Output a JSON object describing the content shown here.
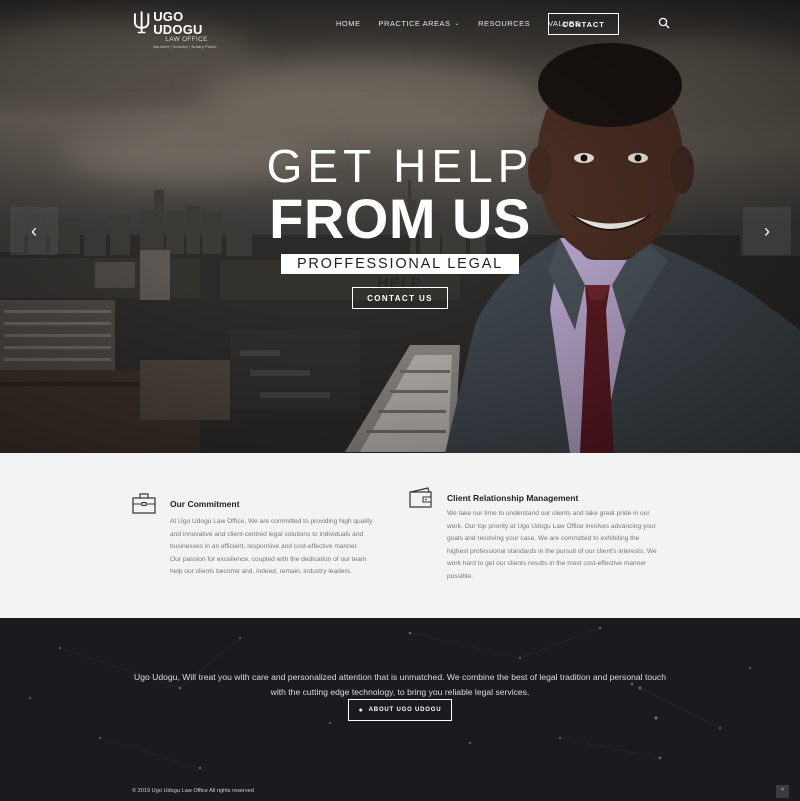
{
  "brand": {
    "name": "UGO UDOGU",
    "sub": "LAW OFFICE",
    "tagline": "Barrister | Solicitor | Notary Public"
  },
  "nav": {
    "items": [
      {
        "label": "HOME"
      },
      {
        "label": "PRACTICE AREAS",
        "has_dropdown": true
      },
      {
        "label": "RESOURCES"
      },
      {
        "label": "VALUES"
      }
    ],
    "contact_label": "CONTACT",
    "search_icon": "search-icon"
  },
  "hero": {
    "line1": "GET HELP",
    "line2": "FROM US",
    "line3": "PROFFESSIONAL LEGAL HELP",
    "cta_label": "CONTACT US",
    "arrow_left": "‹",
    "arrow_right": "›"
  },
  "features": [
    {
      "icon": "briefcase-icon",
      "title": "Our Commitment",
      "lines": [
        "At Ugo Udogu Law Office, We are committed to providing high quality",
        "and innovative and client-centred legal solutions to individuals and",
        "businesses in an efficient, responsive and cost-effective manner.",
        "Our passion for excellence, coupled with the dedication of our team",
        "help our clients become and, indeed, remain, industry leaders."
      ]
    },
    {
      "icon": "wallet-icon",
      "title": "Client Relationship Management",
      "lines": [
        "We take our time to understand our clients and take great pride in our",
        "work. Our top priority at Ugo Udogu Law Office involves advancing your",
        "goals and resolving your case. We are committed to exhibiting the",
        "highest professional standards in the pursuit of our client's interests. We",
        "work hard to get our clients results in the most cost-effective manner",
        "possible."
      ]
    }
  ],
  "footer": {
    "line1": "Ugo Udogu, Will treat you with care and personalized attention that is unmatched. We combine the best of legal tradition and personal touch",
    "line2": "with the cutting edge technology, to bring you reliable legal services.",
    "about_label": "ABOUT UGO UDOGU",
    "copyright": "© 2019 Ugo Udogu Law Office All rights reserved",
    "to_top": "^"
  },
  "colors": {
    "feature_bg": "#f3f3f3",
    "footer_bg": "#1a1b1f",
    "heading": "#222222",
    "body_text": "#777777"
  }
}
